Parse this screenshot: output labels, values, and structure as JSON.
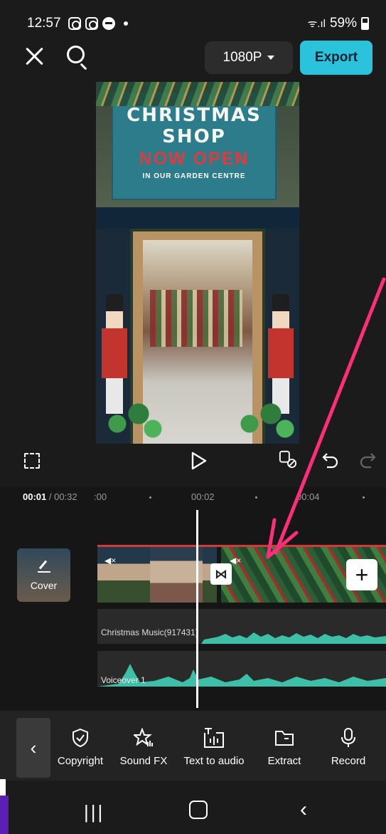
{
  "status_bar": {
    "time": "12:57",
    "signal": "ᯤ.ıl",
    "battery": "59%"
  },
  "toolbar": {
    "resolution": "1080P",
    "export_label": "Export"
  },
  "preview": {
    "sign_line1": "CHRISTMAS",
    "sign_line2": "SHOP",
    "sign_line3": "NOW OPEN",
    "sign_line4": "IN OUR GARDEN CENTRE"
  },
  "timeline": {
    "current_time": "00:01",
    "total_time": "/ 00:32",
    "ruler_labels": [
      ":00",
      "00:02",
      "00:04"
    ],
    "cover_label": "Cover",
    "audio_tracks": [
      {
        "name": "Christmas Music(917431)"
      },
      {
        "name": "Voiceover 1"
      }
    ]
  },
  "bottom_tools": [
    {
      "label": "Copyright",
      "icon": "shield-check-icon"
    },
    {
      "label": "Sound FX",
      "icon": "star-sound-icon"
    },
    {
      "label": "Text to audio",
      "icon": "text-audio-icon"
    },
    {
      "label": "Extract",
      "icon": "folder-icon"
    },
    {
      "label": "Record",
      "icon": "microphone-icon"
    }
  ],
  "colors": {
    "accent": "#2bc3dc",
    "background": "#1b1b1b",
    "waveform": "#3dbfa8",
    "annotation_arrow": "#ff2d7a"
  }
}
